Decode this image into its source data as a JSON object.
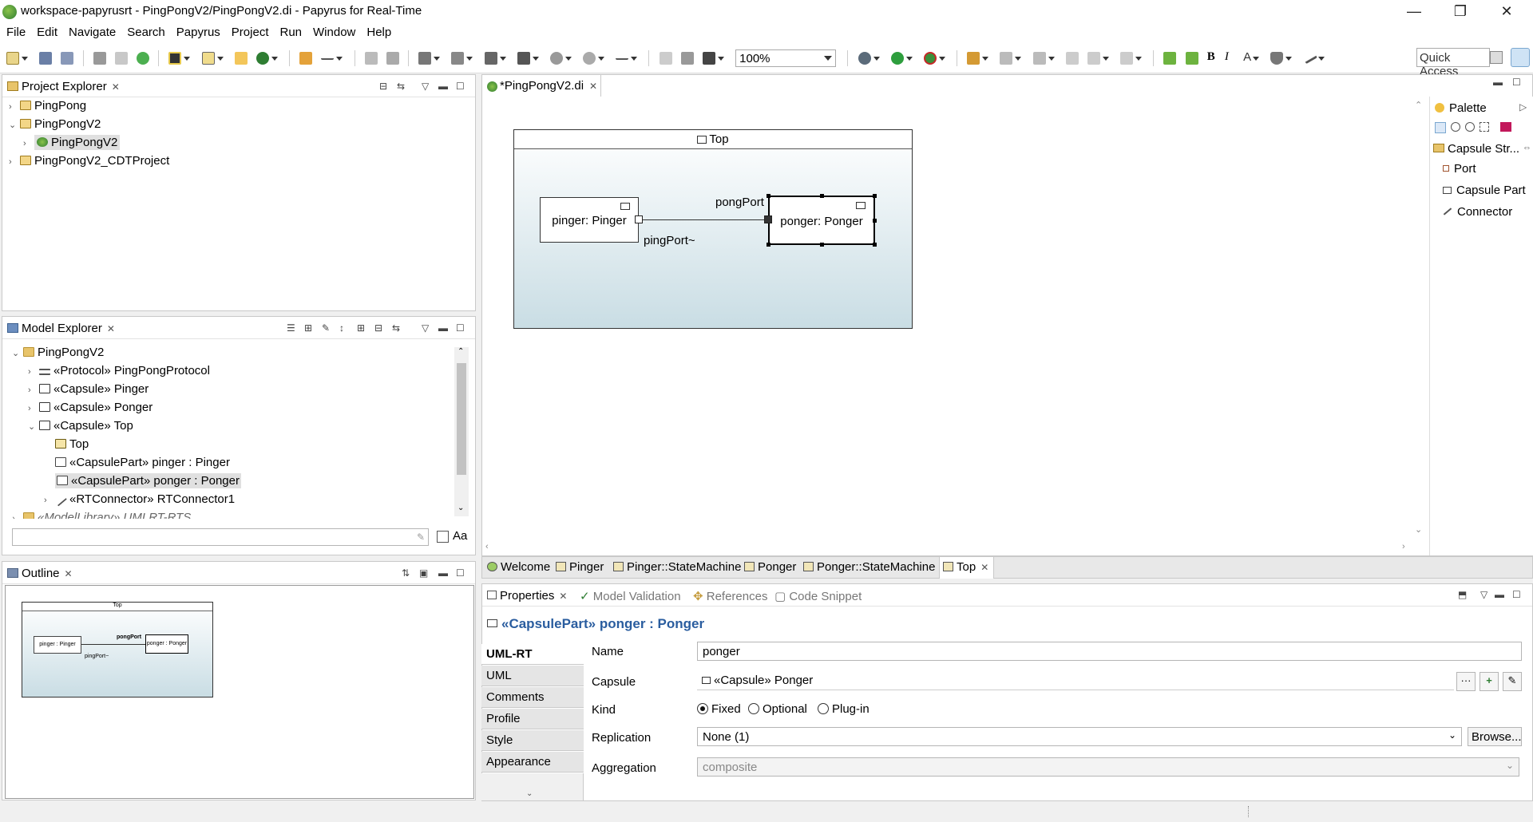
{
  "window": {
    "title": "workspace-papyrusrt - PingPongV2/PingPongV2.di - Papyrus for Real-Time",
    "minimize": "—",
    "restore": "❐",
    "close": "✕"
  },
  "menu": [
    "File",
    "Edit",
    "Navigate",
    "Search",
    "Papyrus",
    "Project",
    "Run",
    "Window",
    "Help"
  ],
  "toolbar": {
    "zoom": "100%",
    "bold": "B",
    "italic": "I",
    "font_color": "A",
    "quick_access": "Quick Access"
  },
  "project_explorer": {
    "title": "Project Explorer",
    "items": [
      {
        "label": "PingPong",
        "expanded": false
      },
      {
        "label": "PingPongV2",
        "expanded": true
      },
      {
        "label": "PingPongV2",
        "selected": true
      },
      {
        "label": "PingPongV2_CDTProject",
        "expanded": false
      }
    ]
  },
  "model_explorer": {
    "title": "Model Explorer",
    "items": [
      {
        "label": "PingPongV2"
      },
      {
        "label": "«Protocol» PingPongProtocol"
      },
      {
        "label": "«Capsule» Pinger"
      },
      {
        "label": "«Capsule» Ponger"
      },
      {
        "label": "«Capsule» Top"
      },
      {
        "label": "Top"
      },
      {
        "label": "«CapsulePart» pinger : Pinger"
      },
      {
        "label": "«CapsulePart» ponger : Ponger"
      },
      {
        "label": "«RTConnector» RTConnector1"
      },
      {
        "label": "«ModelLibrary» UMLRT-RTS"
      }
    ],
    "filter_placeholder": "",
    "case_label": "Aa"
  },
  "outline": {
    "title": "Outline",
    "mini": {
      "top": "Top",
      "pinger": "pinger : Pinger",
      "pongport": "pongPort",
      "ponger": "ponger : Ponger",
      "pingport": "pingPort~"
    }
  },
  "editor": {
    "tab": "*PingPongV2.di",
    "diagram": {
      "capsule_title": "Top",
      "pinger_part": "pinger: Pinger",
      "ponger_part": "ponger: Ponger",
      "pong_port": "pongPort",
      "ping_port": "pingPort~"
    },
    "bottom_tabs": [
      "Welcome",
      "Pinger",
      "Pinger::StateMachine",
      "Ponger",
      "Ponger::StateMachine",
      "Top"
    ]
  },
  "palette": {
    "title": "Palette",
    "drawer": "Capsule Str...",
    "items": [
      "Port",
      "Capsule Part",
      "Connector"
    ]
  },
  "properties": {
    "tabs": [
      "Properties",
      "Model Validation",
      "References",
      "Code Snippet"
    ],
    "header": "«CapsulePart» ponger : Ponger",
    "side_tabs": [
      "UML-RT",
      "UML",
      "Comments",
      "Profile",
      "Style",
      "Appearance"
    ],
    "name_label": "Name",
    "name_value": "ponger",
    "capsule_label": "Capsule",
    "capsule_value": "«Capsule» Ponger",
    "kind_label": "Kind",
    "kind_options": [
      "Fixed",
      "Optional",
      "Plug-in"
    ],
    "kind_selected": "Fixed",
    "replication_label": "Replication",
    "replication_value": "None (1)",
    "browse": "Browse...",
    "aggregation_label": "Aggregation",
    "aggregation_value": "composite"
  }
}
